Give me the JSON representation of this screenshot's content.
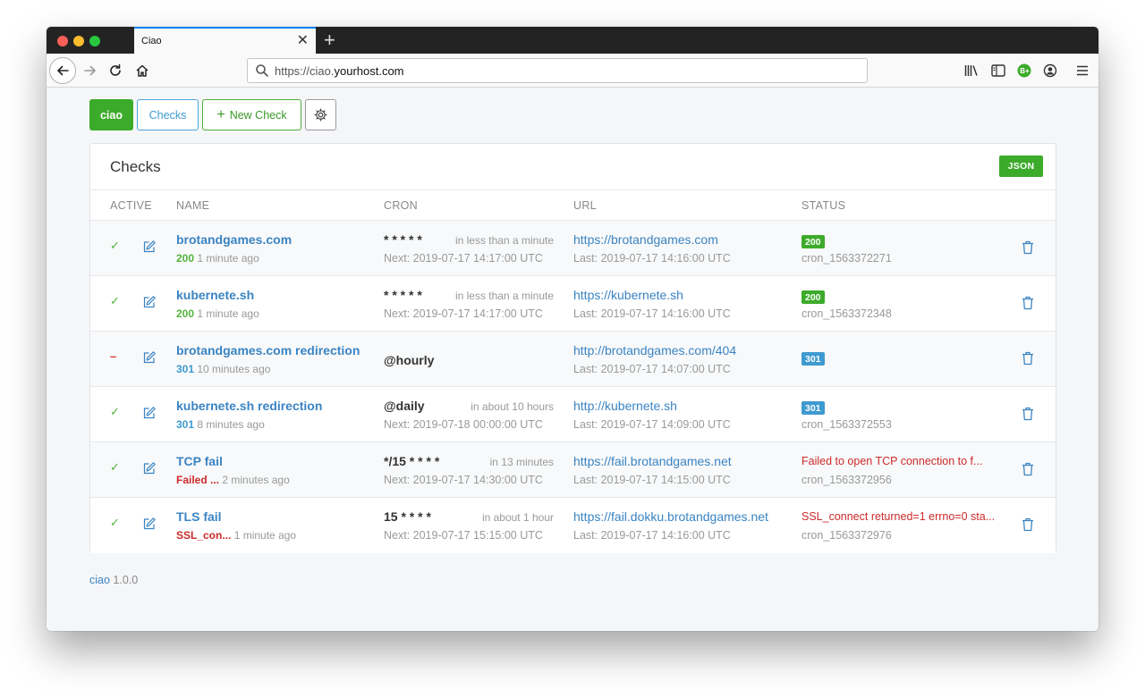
{
  "browser": {
    "tab_title": "Ciao",
    "url_prefix": "https://ciao.",
    "url_host": "yourhost.com"
  },
  "toolbar": {
    "ciao_label": "ciao",
    "checks_label": "Checks",
    "new_check_label": "New Check"
  },
  "panel": {
    "title": "Checks",
    "json_label": "JSON"
  },
  "table": {
    "headers": [
      "ACTIVE",
      "NAME",
      "CRON",
      "URL",
      "STATUS"
    ],
    "rows": [
      {
        "active": "✓",
        "name": "brotandgames.com",
        "code": "200",
        "ago": "1 minute ago",
        "cron": "* * * * *",
        "cron_rel": "in less than a minute",
        "next": "Next: 2019-07-17 14:17:00 UTC",
        "url": "https://brotandgames.com",
        "last": "Last: 2019-07-17 14:16:00 UTC",
        "status": "200",
        "job": "cron_1563372271"
      },
      {
        "active": "✓",
        "name": "kubernete.sh",
        "code": "200",
        "ago": "1 minute ago",
        "cron": "* * * * *",
        "cron_rel": "in less than a minute",
        "next": "Next: 2019-07-17 14:17:00 UTC",
        "url": "https://kubernete.sh",
        "last": "Last: 2019-07-17 14:16:00 UTC",
        "status": "200",
        "job": "cron_1563372348"
      },
      {
        "active": "–",
        "name": "brotandgames.com redirection",
        "code": "301",
        "ago": "10 minutes ago",
        "cron": "@hourly",
        "cron_rel": "",
        "next": "",
        "url": "http://brotandgames.com/404",
        "last": "Last: 2019-07-17 14:07:00 UTC",
        "status": "301",
        "job": ""
      },
      {
        "active": "✓",
        "name": "kubernete.sh redirection",
        "code": "301",
        "ago": "8 minutes ago",
        "cron": "@daily",
        "cron_rel": "in about 10 hours",
        "next": "Next: 2019-07-18 00:00:00 UTC",
        "url": "http://kubernete.sh",
        "last": "Last: 2019-07-17 14:09:00 UTC",
        "status": "301",
        "job": "cron_1563372553"
      },
      {
        "active": "✓",
        "name": "TCP fail",
        "code": "Failed ...",
        "ago": "2 minutes ago",
        "cron": "*/15 * * * *",
        "cron_rel": "in 13 minutes",
        "next": "Next: 2019-07-17 14:30:00 UTC",
        "url": "https://fail.brotandgames.net",
        "last": "Last: 2019-07-17 14:15:00 UTC",
        "status": "Failed to open TCP connection to f...",
        "job": "cron_1563372956"
      },
      {
        "active": "✓",
        "name": "TLS fail",
        "code": "SSL_con...",
        "ago": "1 minute ago",
        "cron": "15 * * * *",
        "cron_rel": "in about 1 hour",
        "next": "Next: 2019-07-17 15:15:00 UTC",
        "url": "https://fail.dokku.brotandgames.net",
        "last": "Last: 2019-07-17 14:16:00 UTC",
        "status": "SSL_connect returned=1 errno=0 sta...",
        "job": "cron_1563372976"
      }
    ]
  },
  "footer": {
    "brand": "ciao",
    "version": "1.0.0"
  },
  "colors": {
    "green": "#3cab2a",
    "blue": "#3e9ad0",
    "link": "#3a84c3",
    "red": "#cc2a2a"
  }
}
